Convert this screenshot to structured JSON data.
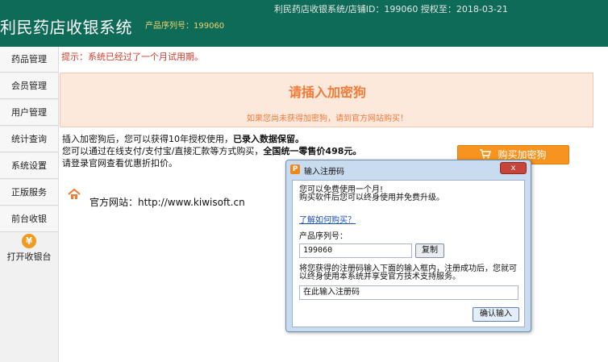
{
  "header": {
    "title": "利民药店收银系统",
    "serial_label": "产品序列号：199060",
    "info": "利民药店收银系统/店铺ID：199060 授权至：2018-03-21"
  },
  "sidebar": {
    "items": [
      {
        "label": "药品管理"
      },
      {
        "label": "会员管理"
      },
      {
        "label": "用户管理"
      },
      {
        "label": "统计查询"
      },
      {
        "label": "系统设置"
      },
      {
        "label": "正版服务"
      },
      {
        "label": "前台收银"
      }
    ],
    "checkout_icon": "¥",
    "checkout_label": "打开收银台"
  },
  "main": {
    "notice": "提示：系统已经过了一个月试用期。",
    "dongle_title": "请插入加密狗",
    "dongle_sub": "如果您尚未获得加密狗，请到官方网站购买！",
    "info_line1_a": "插入加密狗后，您可以获得10年授权使用，",
    "info_line1_b": "已录入数据保留。",
    "info_line2_a": "您可以通过在线支付/支付宝/直接汇款等方式购买，",
    "info_line2_b": "全国统一零售价498元。",
    "info_line3": "请登录官网查看优惠折扣价。",
    "buy_button": "购买加密狗",
    "website": "官方网站：http://www.kiwisoft.cn"
  },
  "dialog": {
    "title": "输入注册码",
    "close": "x",
    "app_icon": "P",
    "line1": "您可以免费使用一个月!",
    "line2": "购买软件后您可以终身使用并免费升级。",
    "learn_link": "了解如何购买？",
    "serial_label": "产品序列号：",
    "serial_value": "199060",
    "copy_button": "复制",
    "instruct1": "将您获得的注册码输入下面的输入框内，注册成功后，您就可",
    "instruct2": "以终身使用本系统并享受官方技术支持服务。",
    "regcode_placeholder": "在此输入注册码",
    "confirm_button": "确认输入"
  },
  "colors": {
    "header_bg": "#0e6b57",
    "accent_orange": "#f6941f",
    "notice_red": "#d23a2a",
    "dongle_bg": "#fce9dc"
  },
  "icons": {
    "cart": "cart-icon",
    "home": "home-icon",
    "yen": "yen-icon",
    "close": "close-icon"
  }
}
